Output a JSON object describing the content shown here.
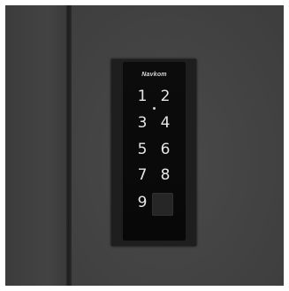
{
  "scene": {
    "keypad": {
      "brand": "Navkom",
      "keys": [
        {
          "label": "1"
        },
        {
          "label": "2"
        },
        {
          "label": "3"
        },
        {
          "label": "4"
        },
        {
          "label": "5"
        },
        {
          "label": "6"
        },
        {
          "label": "7"
        },
        {
          "label": "8"
        },
        {
          "label": "9"
        }
      ]
    }
  }
}
